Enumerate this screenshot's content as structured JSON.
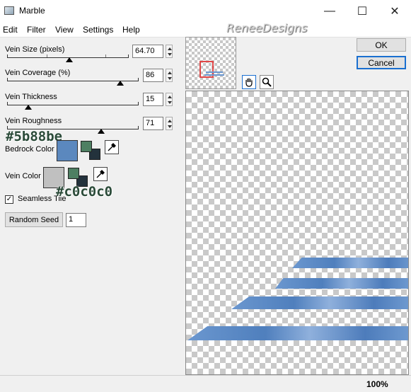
{
  "window": {
    "title": "Marble",
    "buttons": {
      "minimize": "—",
      "maximize": "☐",
      "close": "✕"
    }
  },
  "menu": [
    "Edit",
    "Filter",
    "View",
    "Settings",
    "Help"
  ],
  "watermark": "ReneeDesigns",
  "params": [
    {
      "label": "Vein Size (pixels)",
      "value": "64.70"
    },
    {
      "label": "Vein Coverage (%)",
      "value": "86"
    },
    {
      "label": "Vein Thickness",
      "value": "15"
    },
    {
      "label": "Vein Roughness",
      "value": "71"
    }
  ],
  "bedrock": {
    "label": "Bedrock Color",
    "annotation": "#5b88be",
    "color": "#5b88be",
    "fg_color": "#4e7f62",
    "bg_color": "#23323c"
  },
  "vein": {
    "label": "Vein Color",
    "annotation": "#c0c0c0",
    "color": "#c0c0c0",
    "fg_color": "#4e7f62",
    "bg_color": "#23323c"
  },
  "seamless": {
    "label": "Seamless Tile",
    "checked": true,
    "mark": "✓"
  },
  "random_seed": {
    "button_label": "Random Seed",
    "value": "1"
  },
  "actions": {
    "ok": "OK",
    "cancel": "Cancel"
  },
  "status": {
    "zoom": "100%"
  },
  "colors": {
    "accent_selection": "#1a6fd0",
    "stripe": "#5b88be"
  }
}
